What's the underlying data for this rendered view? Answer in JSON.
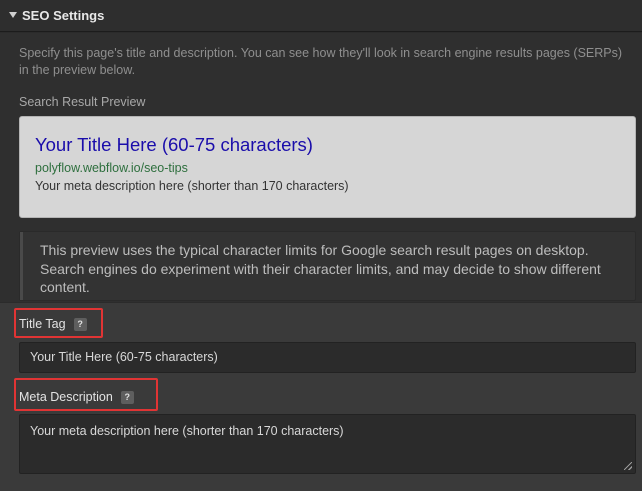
{
  "panel": {
    "title": "SEO Settings",
    "intro": "Specify this page's title and description. You can see how they'll look in search engine results pages (SERPs) in the preview below."
  },
  "preview": {
    "label": "Search Result Preview",
    "title": "Your Title Here (60-75 characters)",
    "url": "polyflow.webflow.io/seo-tips",
    "description": "Your meta description here (shorter than 170 characters)"
  },
  "note": {
    "text": "This preview uses the typical character limits for Google search result pages on desktop. Search engines do experiment with their character limits, and may decide to show different content."
  },
  "title_tag": {
    "label": "Title Tag",
    "help": "?",
    "value": "Your Title Here (60-75 characters)"
  },
  "meta_description": {
    "label": "Meta Description",
    "help": "?",
    "value": "Your meta description here (shorter than 170 characters)"
  },
  "colors": {
    "highlight": "#e03434",
    "preview_title": "#1a0dab",
    "preview_url": "#2e6f3e"
  },
  "icons": [
    "caret-down-icon",
    "help-icon",
    "resize-handle-icon"
  ]
}
